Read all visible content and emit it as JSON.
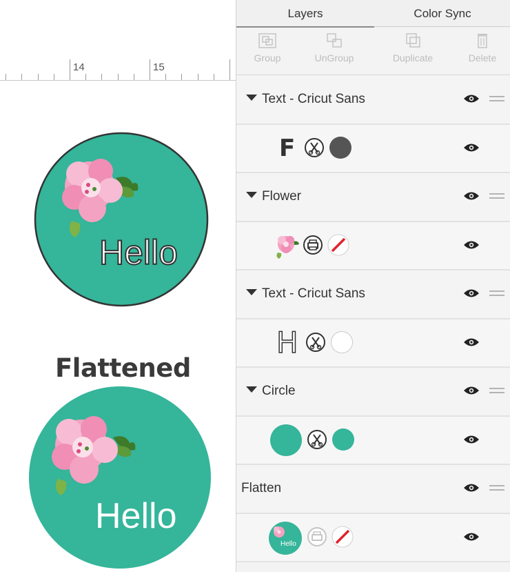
{
  "canvas": {
    "ruler": {
      "labels": [
        "14",
        "15"
      ]
    },
    "flattened_title": "Flattened",
    "hello_text": "Hello",
    "colors": {
      "teal": "#35b59a",
      "outline": "#333333"
    }
  },
  "panel": {
    "tabs": [
      {
        "label": "Layers",
        "active": true
      },
      {
        "label": "Color Sync",
        "active": false
      }
    ],
    "toolbar": [
      {
        "label": "Group",
        "icon": "group-icon",
        "enabled": false
      },
      {
        "label": "UnGroup",
        "icon": "ungroup-icon",
        "enabled": false
      },
      {
        "label": "Duplicate",
        "icon": "duplicate-icon",
        "enabled": false
      },
      {
        "label": "Delete",
        "icon": "trash-icon",
        "enabled": false
      }
    ],
    "layers": [
      {
        "group": "Text - Cricut Sans",
        "item": {
          "thumbnail": "F",
          "operation": "cut",
          "color": "#555555"
        }
      },
      {
        "group": "Flower",
        "item": {
          "thumbnail": "flower-image",
          "operation": "print-then-cut",
          "color": "none"
        }
      },
      {
        "group": "Text - Cricut Sans",
        "item": {
          "thumbnail": "H",
          "operation": "cut",
          "color": "#ffffff"
        }
      },
      {
        "group": "Circle",
        "item": {
          "thumbnail": "circle",
          "operation": "cut",
          "color": "#35b59a"
        }
      },
      {
        "group": "Flatten",
        "item": {
          "thumbnail": "Hello",
          "operation": "print-then-cut",
          "color": "none"
        }
      }
    ]
  }
}
